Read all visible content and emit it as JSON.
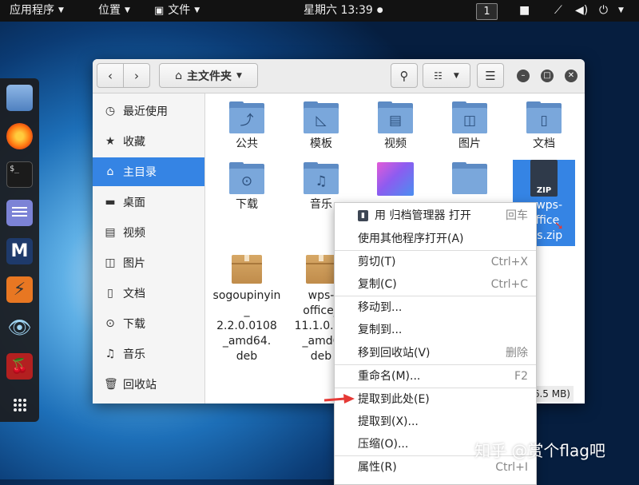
{
  "topbar": {
    "applications": "应用程序",
    "places": "位置",
    "files": "文件",
    "clock": "星期六 13:39",
    "workspace": "1"
  },
  "window": {
    "location": "主文件夹",
    "status": "26.5 MB)"
  },
  "sidebar": {
    "items": [
      {
        "label": "最近使用",
        "icon": "clock-icon"
      },
      {
        "label": "收藏",
        "icon": "star-icon"
      },
      {
        "label": "主目录",
        "icon": "home-icon"
      },
      {
        "label": "桌面",
        "icon": "desktop-icon"
      },
      {
        "label": "视频",
        "icon": "video-icon"
      },
      {
        "label": "图片",
        "icon": "image-icon"
      },
      {
        "label": "文档",
        "icon": "document-icon"
      },
      {
        "label": "下载",
        "icon": "download-icon"
      },
      {
        "label": "音乐",
        "icon": "music-icon"
      },
      {
        "label": "回收站",
        "icon": "trash-icon"
      }
    ]
  },
  "files": [
    {
      "name": "公共",
      "type": "folder",
      "icon": "share-icon"
    },
    {
      "name": "模板",
      "type": "folder",
      "icon": "template-icon"
    },
    {
      "name": "视频",
      "type": "folder",
      "icon": "video-icon"
    },
    {
      "name": "图片",
      "type": "folder",
      "icon": "image-icon"
    },
    {
      "name": "文档",
      "type": "folder",
      "icon": "document-icon"
    },
    {
      "name": "下载",
      "type": "folder",
      "icon": "download-icon"
    },
    {
      "name": "音乐",
      "type": "folder",
      "icon": "music-icon"
    },
    {
      "name": "",
      "type": "folder",
      "icon": "desktop-icon"
    },
    {
      "name": "",
      "type": "folder",
      "icon": "folder-icon"
    },
    {
      "name_lines": [
        "x-wps-",
        "office",
        "nts.zip"
      ],
      "type": "zip",
      "icon": "zip-icon",
      "icon_label": "ZIP"
    },
    {
      "name_lines": [
        "sogoupinyin",
        "_",
        "2.2.0.0108",
        "_amd64.",
        "deb"
      ],
      "type": "deb",
      "icon": "package-icon"
    },
    {
      "name_lines": [
        "wps-",
        "office_",
        "11.1.0.87",
        "_amd6",
        "deb"
      ],
      "type": "deb",
      "icon": "package-icon"
    }
  ],
  "context_menu": {
    "items": [
      {
        "label": "用 归档管理器 打开",
        "shortcut": "回车",
        "icon": "archive-manager-icon"
      },
      {
        "label": "使用其他程序打开(A)",
        "shortcut": ""
      },
      {
        "label": "剪切(T)",
        "shortcut": "Ctrl+X"
      },
      {
        "label": "复制(C)",
        "shortcut": "Ctrl+C"
      },
      {
        "label": "移动到...",
        "shortcut": ""
      },
      {
        "label": "复制到...",
        "shortcut": ""
      },
      {
        "label": "移到回收站(V)",
        "shortcut": "删除"
      },
      {
        "label": "重命名(M)...",
        "shortcut": "F2"
      },
      {
        "label": "提取到此处(E)",
        "shortcut": ""
      },
      {
        "label": "提取到(X)...",
        "shortcut": ""
      },
      {
        "label": "压缩(O)...",
        "shortcut": ""
      },
      {
        "label": "属性(R)",
        "shortcut": "Ctrl+I"
      }
    ]
  },
  "watermark": "知乎 @赏个flag吧",
  "colors": {
    "accent": "#3584e4",
    "folder": "#7aa7db",
    "arrow": "#e53935"
  }
}
